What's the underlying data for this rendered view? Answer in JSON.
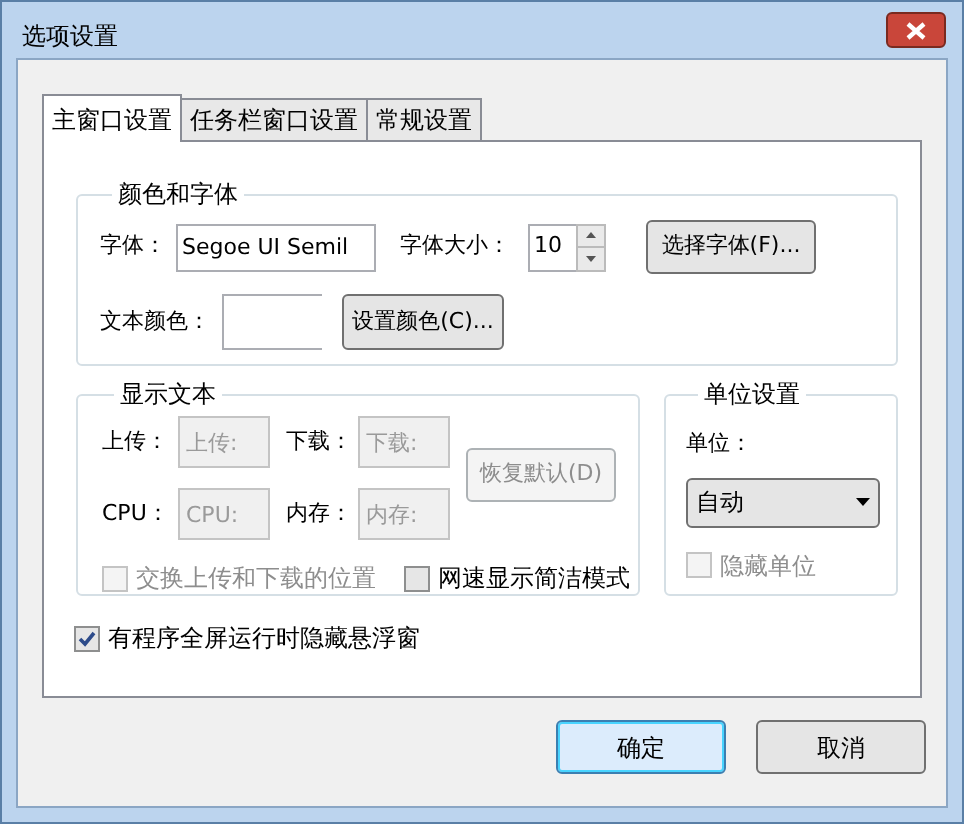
{
  "window": {
    "title": "选项设置"
  },
  "tabs": [
    {
      "label": "主窗口设置",
      "selected": true
    },
    {
      "label": "任务栏窗口设置",
      "selected": false
    },
    {
      "label": "常规设置",
      "selected": false
    }
  ],
  "font_group": {
    "title": "颜色和字体",
    "font_label": "字体：",
    "font_value": "Segoe UI Semil",
    "size_label": "字体大小：",
    "size_value": "10",
    "choose_font_button": "选择字体(F)...",
    "color_label": "文本颜色：",
    "set_color_button": "设置颜色(C)..."
  },
  "display_text_group": {
    "title": "显示文本",
    "fields": [
      {
        "label": "上传：",
        "placeholder": "上传:",
        "disabled": true
      },
      {
        "label": "下载：",
        "placeholder": "下载:",
        "disabled": true
      },
      {
        "label": "CPU：",
        "placeholder": "CPU:",
        "disabled": true
      },
      {
        "label": "内存：",
        "placeholder": "内存:",
        "disabled": true
      }
    ],
    "restore_button": {
      "label": "恢复默认(D)",
      "disabled": true
    },
    "checkboxes": [
      {
        "label": "交换上传和下载的位置",
        "checked": false,
        "disabled": true
      },
      {
        "label": "网速显示简洁模式",
        "checked": false,
        "disabled": false
      }
    ]
  },
  "unit_group": {
    "title": "单位设置",
    "unit_label": "单位：",
    "unit_value": "自动",
    "hide_unit": {
      "label": "隐藏单位",
      "checked": false,
      "disabled": true
    }
  },
  "fullscreen_hide": {
    "label": "有程序全屏运行时隐藏悬浮窗",
    "checked": true,
    "disabled": false
  },
  "buttons": [
    {
      "label": "确定",
      "kind": "default"
    },
    {
      "label": "取消",
      "kind": "normal"
    }
  ]
}
